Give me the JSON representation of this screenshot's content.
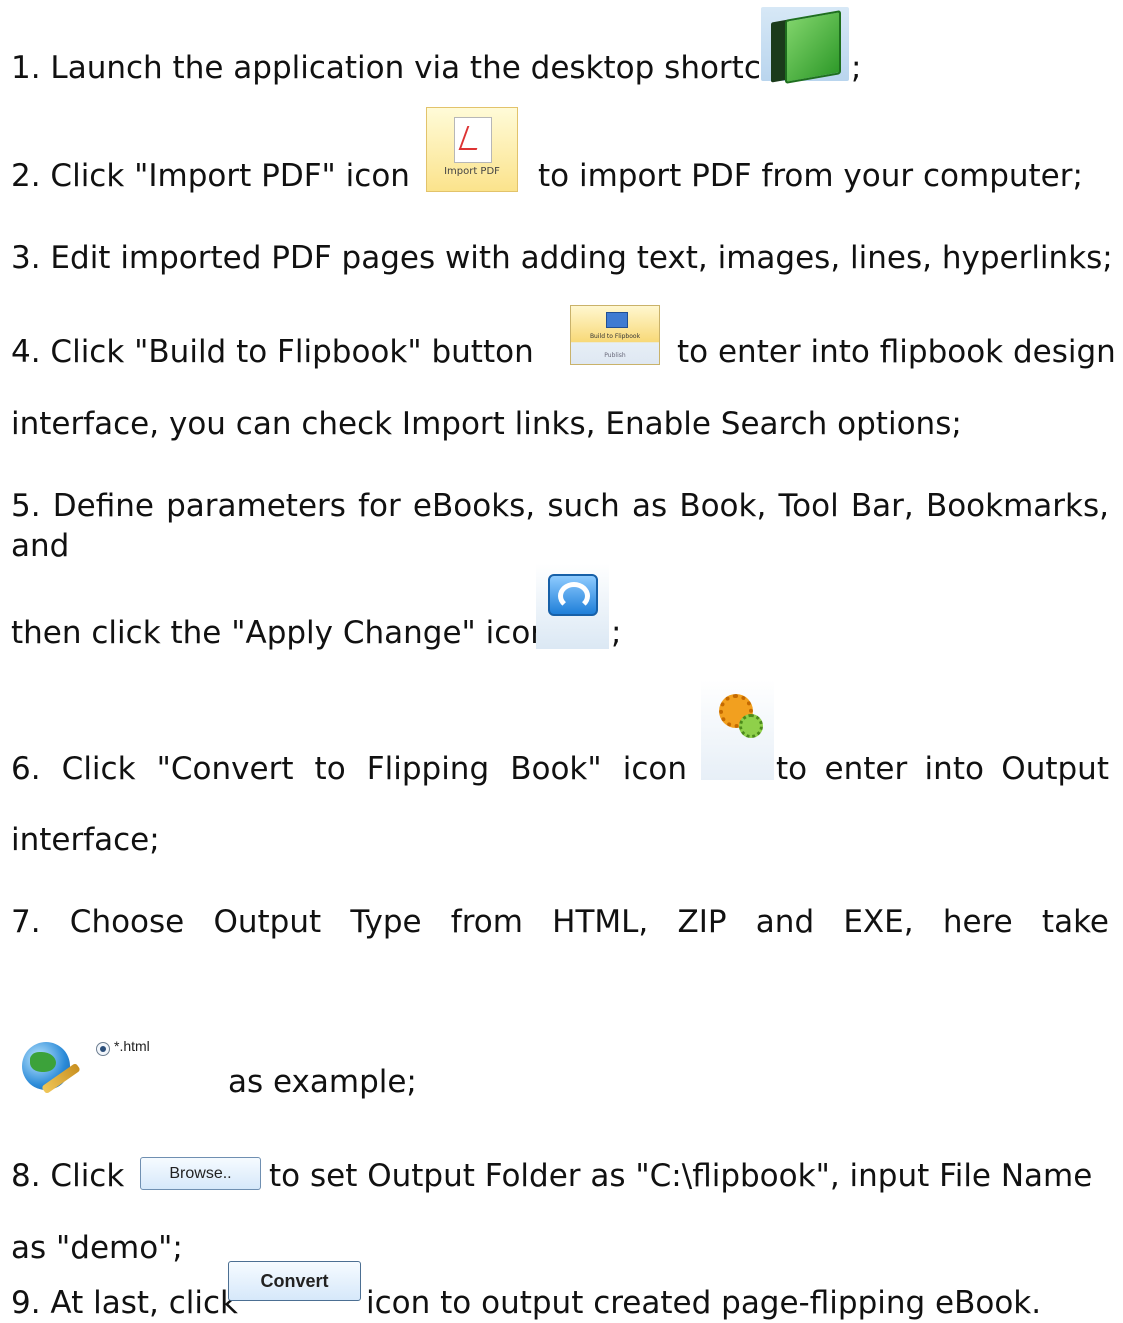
{
  "steps": [
    {
      "text": "1. Launch the application via the desktop shortcut",
      "suffix": ";"
    },
    {
      "pre": "2. Click \"Import PDF\" icon",
      "post": "to import PDF from your computer;"
    },
    {
      "text": "3. Edit imported PDF pages with adding text, images, lines, hyperlinks;"
    },
    {
      "pre": "4. Click \"Build to Flipbook\" button",
      "post": "to enter into flipbook design",
      "cont": "interface, you can check Import links, Enable Search options;"
    },
    {
      "text": "5. Define parameters for eBooks, such as Book, Tool Bar, Bookmarks, and",
      "cont": "then click the \"Apply Change\" icon",
      "suffix": ";"
    },
    {
      "pre": "6. Click \"Convert to Flipping Book\" icon",
      "post": "to enter into Output",
      "cont": "interface;"
    },
    {
      "text": "7. Choose Output Type from HTML, ZIP and EXE, here take",
      "cont": "as example;"
    },
    {
      "pre": "8. Click",
      "post": "to set Output Folder as \"C:\\flipbook\", input File Name",
      "cont": "as \"demo\";"
    },
    {
      "pre": "9. At last, click",
      "post": "icon to output created page-flipping eBook."
    }
  ],
  "icons": {
    "import_pdf_label": "Import PDF",
    "build_label": "Build to Flipbook",
    "build_sub": "Publish",
    "radio_label": "*.html",
    "browse_label": "Browse..",
    "convert_label": "Convert"
  }
}
